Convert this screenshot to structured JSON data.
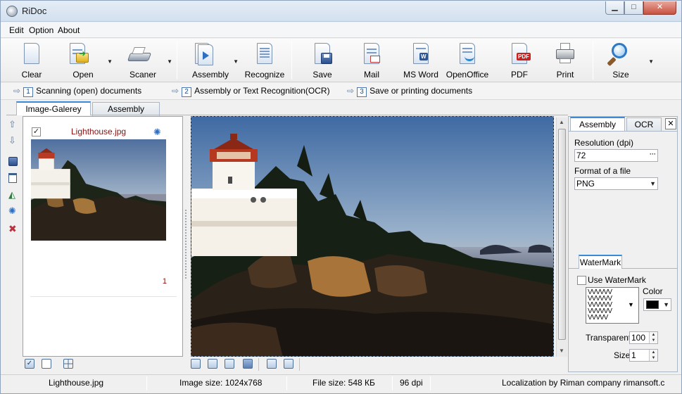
{
  "window": {
    "title": "RiDoc"
  },
  "menu": [
    "Edit",
    "Option",
    "About"
  ],
  "toolbar": {
    "clear": "Clear",
    "open": "Open",
    "scaner": "Scaner",
    "assembly": "Assembly",
    "recognize": "Recognize",
    "save": "Save",
    "mail": "Mail",
    "msword": "MS Word",
    "openoffice": "OpenOffice",
    "pdf": "PDF",
    "print": "Print",
    "size": "Size"
  },
  "steps": [
    {
      "num": "1",
      "label": "Scanning (open) documents"
    },
    {
      "num": "2",
      "label": "Assembly or Text Recognition(OCR)"
    },
    {
      "num": "3",
      "label": "Save or printing documents"
    }
  ],
  "tabs": {
    "gallery": "Image-Galerey",
    "assembly": "Assembly"
  },
  "thumbnail": {
    "filename": "Lighthouse.jpg",
    "page": "1",
    "checked": true
  },
  "right_tabs": {
    "assembly": "Assembly",
    "ocr": "OCR"
  },
  "settings": {
    "resolution_label": "Resolution (dpi)",
    "resolution_value": "72",
    "format_label": "Format of a file",
    "format_value": "PNG",
    "watermark_tab": "WaterMark",
    "use_watermark": "Use WaterMark",
    "color_label": "Color",
    "color_value": "#000000",
    "transparent_label": "Transparent",
    "transparent_value": "100",
    "size_label": "Size",
    "size_value": "1"
  },
  "status": {
    "filename": "Lighthouse.jpg",
    "image_size": "Image size: 1024x768",
    "file_size": "File size: 548 КБ",
    "dpi": "96 dpi",
    "localization": "Localization by Riman company rimansoft.c"
  }
}
